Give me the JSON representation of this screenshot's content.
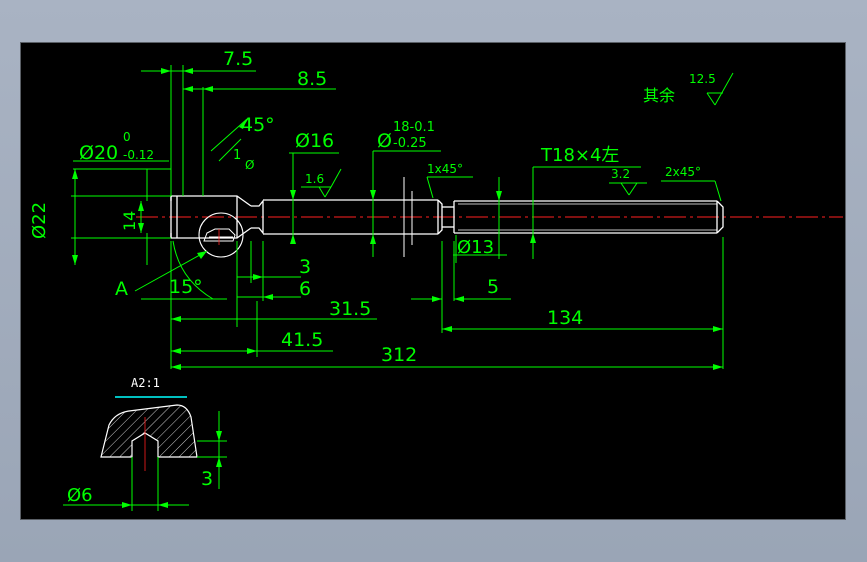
{
  "drawing": {
    "dims": {
      "d75": "7.5",
      "d85": "8.5",
      "a45": "45°",
      "phi16": "Ø16",
      "phi20": "Ø20",
      "phi20_up": "0",
      "phi20_lo": "-0.12",
      "phi_t": "Ø",
      "tol_up": "18-0.1",
      "tol_lo": "-0.25",
      "phi22": "Ø22",
      "d14": "14",
      "r16": "1.6",
      "c1x45": "1x45°",
      "t18": "T18×4左",
      "r32": "3.2",
      "c2x45": "2x45°",
      "other": "其余",
      "r125": "12.5",
      "phi13": "Ø13",
      "d3": "3",
      "d6": "6",
      "d315": "31.5",
      "d415": "41.5",
      "d312": "312",
      "d5": "5",
      "d134": "134",
      "lblA": "A",
      "a15": "15°",
      "d1": "1",
      "phi_small": "Ø"
    },
    "detail": {
      "title": "A2:1",
      "phi6": "Ø6",
      "d3": "3"
    },
    "colors": {
      "dimension": "#00ff00",
      "outline": "#ffffff",
      "centerline": "#ff0000",
      "accent": "#00ffff",
      "background": "#000000"
    }
  }
}
